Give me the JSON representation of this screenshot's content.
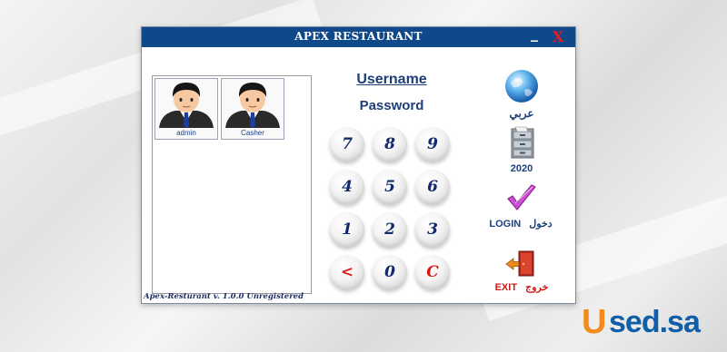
{
  "window": {
    "title": "APEX RESTAURANT",
    "minimize_glyph": "_",
    "close_glyph": "X"
  },
  "users": [
    {
      "name": "admin",
      "icon": "user-avatar-icon"
    },
    {
      "name": "Casher",
      "icon": "user-avatar-icon"
    }
  ],
  "login": {
    "username_label": "Username",
    "password_label": "Password"
  },
  "keypad": {
    "keys": [
      "7",
      "8",
      "9",
      "4",
      "5",
      "6",
      "1",
      "2",
      "3",
      "<",
      "0",
      "C"
    ],
    "red_keys": [
      "<",
      "C"
    ],
    "digit_color": "#13296d",
    "control_color": "#d61818"
  },
  "side_buttons": {
    "language_label": "عربي",
    "year_label": "2020",
    "login_label": "LOGIN",
    "login_label_ar": "دخول",
    "exit_label": "EXIT",
    "exit_label_ar": "خروج"
  },
  "footer": {
    "version_text": "Apex-Resturant v. 1.0.0 Unregistered"
  },
  "watermark": {
    "logo_u": "U",
    "logo_rest": "sed.sa"
  },
  "colors": {
    "titlebar": "#10498a",
    "accent": "#1d3f7a",
    "exit": "#cc1b1b",
    "logo_orange": "#f28c1e",
    "logo_blue": "#0f5ea8"
  }
}
